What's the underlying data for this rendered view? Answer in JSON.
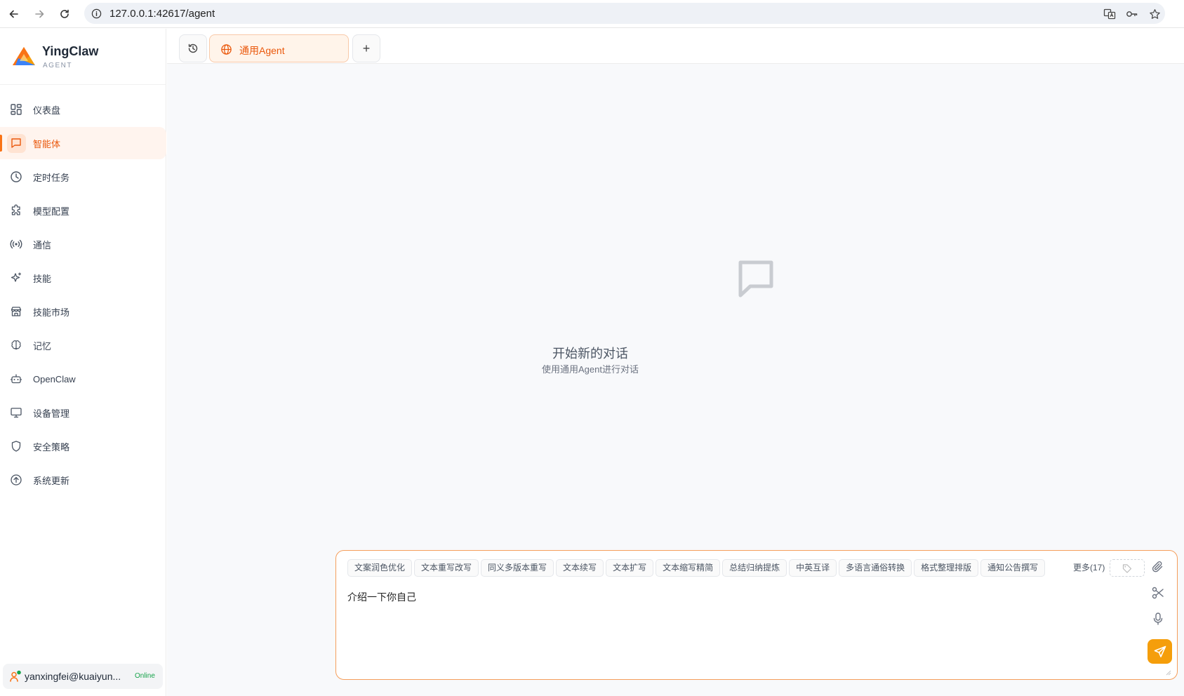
{
  "browser": {
    "url": "127.0.0.1:42617/agent"
  },
  "brand": {
    "name": "YingClaw",
    "subtitle": "AGENT"
  },
  "sidebar": {
    "items": [
      {
        "label": "仪表盘",
        "icon": "dashboard-icon"
      },
      {
        "label": "智能体",
        "icon": "chat-icon",
        "active": true
      },
      {
        "label": "定时任务",
        "icon": "clock-icon"
      },
      {
        "label": "模型配置",
        "icon": "puzzle-icon"
      },
      {
        "label": "通信",
        "icon": "broadcast-icon"
      },
      {
        "label": "技能",
        "icon": "sparkle-icon"
      },
      {
        "label": "技能市场",
        "icon": "store-icon"
      },
      {
        "label": "记忆",
        "icon": "brain-icon"
      },
      {
        "label": "OpenClaw",
        "icon": "robot-icon"
      },
      {
        "label": "设备管理",
        "icon": "monitor-icon"
      },
      {
        "label": "安全策略",
        "icon": "shield-icon"
      },
      {
        "label": "系统更新",
        "icon": "upload-icon"
      }
    ]
  },
  "user": {
    "name": "yanxingfei@kuaiyun...",
    "status": "Online"
  },
  "tabs": {
    "agent_label": "通用Agent",
    "add_label": "+"
  },
  "empty_state": {
    "title": "开始新的对话",
    "subtitle": "使用通用Agent进行对话"
  },
  "composer": {
    "chips": [
      "文案润色优化",
      "文本重写改写",
      "同义多版本重写",
      "文本续写",
      "文本扩写",
      "文本缩写精简",
      "总结归纳提炼",
      "中英互译",
      "多语言通俗转换",
      "格式整理排版",
      "通知公告撰写"
    ],
    "more_label": "更多(17)",
    "input_text": "介绍一下你自己"
  },
  "colors": {
    "accent": "#f97316",
    "accent_light": "#fff4ee",
    "send": "#f59e0b",
    "online": "#16a34a"
  }
}
